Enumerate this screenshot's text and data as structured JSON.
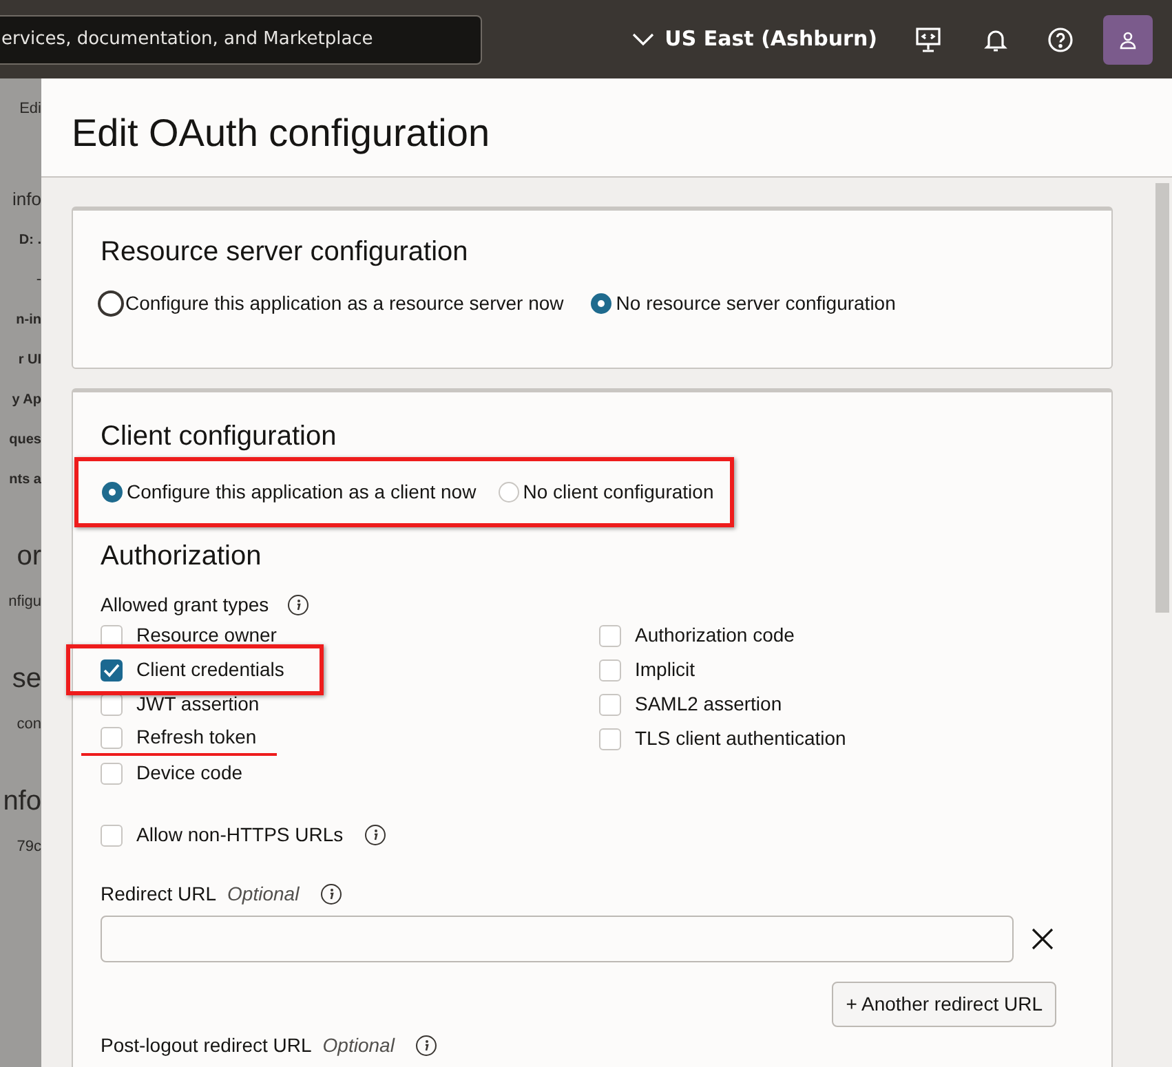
{
  "topbar": {
    "search": {
      "value": "ervices, documentation, and Marketplace"
    },
    "region": "US East (Ashburn)"
  },
  "backdrop": [
    {
      "kind": "tab",
      "text": "Edi"
    },
    {
      "kind": "heading",
      "text": "info"
    },
    {
      "kind": "label",
      "text": "D: ."
    },
    {
      "kind": "text",
      "text": "-"
    },
    {
      "kind": "label",
      "text": "n-in"
    },
    {
      "kind": "label",
      "text": "r UI"
    },
    {
      "kind": "label",
      "text": "y Ap"
    },
    {
      "kind": "label",
      "text": "ques"
    },
    {
      "kind": "label",
      "text": "nts a"
    },
    {
      "kind": "big",
      "text": "or"
    },
    {
      "kind": "text",
      "text": "nfigu"
    },
    {
      "kind": "big",
      "text": "se"
    },
    {
      "kind": "text",
      "text": "con"
    },
    {
      "kind": "big",
      "text": "nfo"
    },
    {
      "kind": "text",
      "text": "79c"
    }
  ],
  "panel": {
    "title": "Edit OAuth configuration",
    "resource_server": {
      "title": "Resource server configuration",
      "options": [
        {
          "label": "Configure this application as a resource server now",
          "selected": false,
          "focused": true
        },
        {
          "label": "No resource server configuration",
          "selected": true,
          "focused": false
        }
      ]
    },
    "client": {
      "title": "Client configuration",
      "highlighted": true,
      "options": [
        {
          "label": "Configure this application as a client now",
          "selected": true,
          "focused": false
        },
        {
          "label": "No client configuration",
          "selected": false,
          "focused": false
        }
      ],
      "authorization": {
        "title": "Authorization",
        "grant_label": "Allowed grant types",
        "grant_types": [
          {
            "label": "Resource owner",
            "checked": false,
            "highlighted": false,
            "underlined": false
          },
          {
            "label": "Client credentials",
            "checked": true,
            "highlighted": true,
            "underlined": false
          },
          {
            "label": "JWT assertion",
            "checked": false,
            "highlighted": false,
            "underlined": false
          },
          {
            "label": "Refresh token",
            "checked": false,
            "highlighted": false,
            "underlined": true
          },
          {
            "label": "Device code",
            "checked": false,
            "highlighted": false,
            "underlined": false
          },
          {
            "label": "Authorization code",
            "checked": false,
            "highlighted": false,
            "underlined": false
          },
          {
            "label": "Implicit",
            "checked": false,
            "highlighted": false,
            "underlined": false
          },
          {
            "label": "SAML2 assertion",
            "checked": false,
            "highlighted": false,
            "underlined": false
          },
          {
            "label": "TLS client authentication",
            "checked": false,
            "highlighted": false,
            "underlined": false
          }
        ],
        "non_https": {
          "label": "Allow non-HTTPS URLs",
          "checked": false
        },
        "redirect_url": {
          "label": "Redirect URL",
          "optional": "Optional"
        },
        "add_button": "+ Another redirect URL",
        "post_logout": {
          "label": "Post-logout redirect URL",
          "optional": "Optional"
        }
      }
    }
  }
}
